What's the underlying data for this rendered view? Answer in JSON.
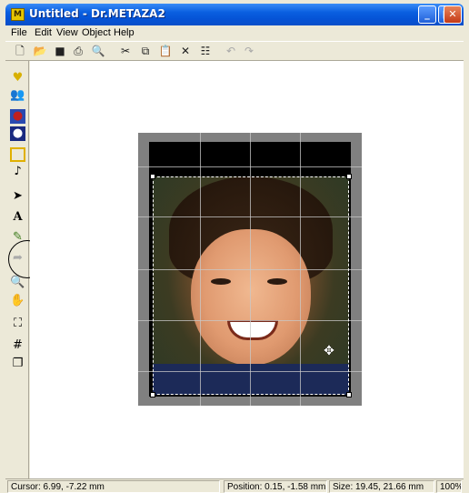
{
  "window": {
    "title": "Untitled - Dr.METAZA2",
    "icon": "app-logo-icon"
  },
  "titlebar_buttons": [
    "minimize",
    "maximize",
    "close"
  ],
  "menu": [
    {
      "label": "File"
    },
    {
      "label": "Edit"
    },
    {
      "label": "View"
    },
    {
      "label": "Object"
    },
    {
      "label": "Help"
    }
  ],
  "toolbar": [
    "new-icon",
    "open-icon",
    "save-icon",
    "print-icon",
    "print-preview-icon",
    "cut-icon",
    "copy-icon",
    "paste-icon",
    "delete-icon",
    "properties-icon",
    "undo-icon",
    "redo-icon"
  ],
  "palette": [
    "heart-frame-icon",
    "group-photo-icon",
    "single-photo-icon",
    "portrait-icon",
    "rectangle-icon",
    "note-icon",
    "select-arrow-icon",
    "text-icon",
    "pen-icon",
    "fill-icon",
    "zoom-icon",
    "hand-icon",
    "fit-icon",
    "grid-icon",
    "layers-icon"
  ],
  "status": {
    "cursor": "Cursor: 6.99, -7.22 mm",
    "position": "Position: 0.15, -1.58 mm",
    "size": "Size: 19.45, 21.66 mm",
    "zoom": "100%"
  }
}
